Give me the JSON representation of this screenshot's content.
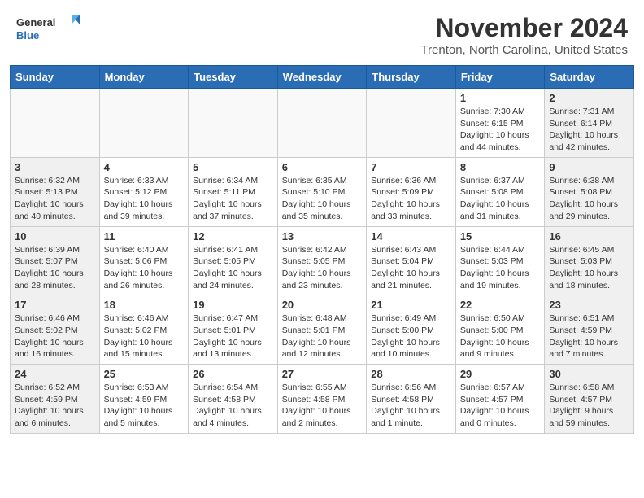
{
  "header": {
    "logo_general": "General",
    "logo_blue": "Blue",
    "title": "November 2024",
    "subtitle": "Trenton, North Carolina, United States"
  },
  "weekdays": [
    "Sunday",
    "Monday",
    "Tuesday",
    "Wednesday",
    "Thursday",
    "Friday",
    "Saturday"
  ],
  "weeks": [
    [
      {
        "day": "",
        "info": ""
      },
      {
        "day": "",
        "info": ""
      },
      {
        "day": "",
        "info": ""
      },
      {
        "day": "",
        "info": ""
      },
      {
        "day": "",
        "info": ""
      },
      {
        "day": "1",
        "info": "Sunrise: 7:30 AM\nSunset: 6:15 PM\nDaylight: 10 hours and 44 minutes."
      },
      {
        "day": "2",
        "info": "Sunrise: 7:31 AM\nSunset: 6:14 PM\nDaylight: 10 hours and 42 minutes."
      }
    ],
    [
      {
        "day": "3",
        "info": "Sunrise: 6:32 AM\nSunset: 5:13 PM\nDaylight: 10 hours and 40 minutes."
      },
      {
        "day": "4",
        "info": "Sunrise: 6:33 AM\nSunset: 5:12 PM\nDaylight: 10 hours and 39 minutes."
      },
      {
        "day": "5",
        "info": "Sunrise: 6:34 AM\nSunset: 5:11 PM\nDaylight: 10 hours and 37 minutes."
      },
      {
        "day": "6",
        "info": "Sunrise: 6:35 AM\nSunset: 5:10 PM\nDaylight: 10 hours and 35 minutes."
      },
      {
        "day": "7",
        "info": "Sunrise: 6:36 AM\nSunset: 5:09 PM\nDaylight: 10 hours and 33 minutes."
      },
      {
        "day": "8",
        "info": "Sunrise: 6:37 AM\nSunset: 5:08 PM\nDaylight: 10 hours and 31 minutes."
      },
      {
        "day": "9",
        "info": "Sunrise: 6:38 AM\nSunset: 5:08 PM\nDaylight: 10 hours and 29 minutes."
      }
    ],
    [
      {
        "day": "10",
        "info": "Sunrise: 6:39 AM\nSunset: 5:07 PM\nDaylight: 10 hours and 28 minutes."
      },
      {
        "day": "11",
        "info": "Sunrise: 6:40 AM\nSunset: 5:06 PM\nDaylight: 10 hours and 26 minutes."
      },
      {
        "day": "12",
        "info": "Sunrise: 6:41 AM\nSunset: 5:05 PM\nDaylight: 10 hours and 24 minutes."
      },
      {
        "day": "13",
        "info": "Sunrise: 6:42 AM\nSunset: 5:05 PM\nDaylight: 10 hours and 23 minutes."
      },
      {
        "day": "14",
        "info": "Sunrise: 6:43 AM\nSunset: 5:04 PM\nDaylight: 10 hours and 21 minutes."
      },
      {
        "day": "15",
        "info": "Sunrise: 6:44 AM\nSunset: 5:03 PM\nDaylight: 10 hours and 19 minutes."
      },
      {
        "day": "16",
        "info": "Sunrise: 6:45 AM\nSunset: 5:03 PM\nDaylight: 10 hours and 18 minutes."
      }
    ],
    [
      {
        "day": "17",
        "info": "Sunrise: 6:46 AM\nSunset: 5:02 PM\nDaylight: 10 hours and 16 minutes."
      },
      {
        "day": "18",
        "info": "Sunrise: 6:46 AM\nSunset: 5:02 PM\nDaylight: 10 hours and 15 minutes."
      },
      {
        "day": "19",
        "info": "Sunrise: 6:47 AM\nSunset: 5:01 PM\nDaylight: 10 hours and 13 minutes."
      },
      {
        "day": "20",
        "info": "Sunrise: 6:48 AM\nSunset: 5:01 PM\nDaylight: 10 hours and 12 minutes."
      },
      {
        "day": "21",
        "info": "Sunrise: 6:49 AM\nSunset: 5:00 PM\nDaylight: 10 hours and 10 minutes."
      },
      {
        "day": "22",
        "info": "Sunrise: 6:50 AM\nSunset: 5:00 PM\nDaylight: 10 hours and 9 minutes."
      },
      {
        "day": "23",
        "info": "Sunrise: 6:51 AM\nSunset: 4:59 PM\nDaylight: 10 hours and 7 minutes."
      }
    ],
    [
      {
        "day": "24",
        "info": "Sunrise: 6:52 AM\nSunset: 4:59 PM\nDaylight: 10 hours and 6 minutes."
      },
      {
        "day": "25",
        "info": "Sunrise: 6:53 AM\nSunset: 4:59 PM\nDaylight: 10 hours and 5 minutes."
      },
      {
        "day": "26",
        "info": "Sunrise: 6:54 AM\nSunset: 4:58 PM\nDaylight: 10 hours and 4 minutes."
      },
      {
        "day": "27",
        "info": "Sunrise: 6:55 AM\nSunset: 4:58 PM\nDaylight: 10 hours and 2 minutes."
      },
      {
        "day": "28",
        "info": "Sunrise: 6:56 AM\nSunset: 4:58 PM\nDaylight: 10 hours and 1 minute."
      },
      {
        "day": "29",
        "info": "Sunrise: 6:57 AM\nSunset: 4:57 PM\nDaylight: 10 hours and 0 minutes."
      },
      {
        "day": "30",
        "info": "Sunrise: 6:58 AM\nSunset: 4:57 PM\nDaylight: 9 hours and 59 minutes."
      }
    ]
  ],
  "accent_color": "#2a6db5"
}
